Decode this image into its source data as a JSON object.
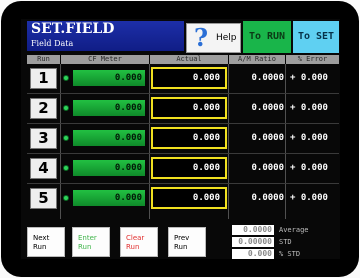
{
  "header": {
    "title": "SET.FIELD",
    "subtitle": "Field Data",
    "help_label": "Help",
    "help_glyph": "?",
    "to_run_label": "To RUN",
    "to_set_label": "To SET"
  },
  "columns": [
    "Run",
    "CF Meter",
    "Actual",
    "A/M Ratio",
    "% Error"
  ],
  "rows": [
    {
      "run": "1",
      "meter": "0.000",
      "actual": "0.000",
      "ratio": "0.0000",
      "error": "+ 0.000"
    },
    {
      "run": "2",
      "meter": "0.000",
      "actual": "0.000",
      "ratio": "0.0000",
      "error": "+ 0.000"
    },
    {
      "run": "3",
      "meter": "0.000",
      "actual": "0.000",
      "ratio": "0.0000",
      "error": "+ 0.000"
    },
    {
      "run": "4",
      "meter": "0.000",
      "actual": "0.000",
      "ratio": "0.0000",
      "error": "+ 0.000"
    },
    {
      "run": "5",
      "meter": "0.000",
      "actual": "0.000",
      "ratio": "0.0000",
      "error": "+ 0.000"
    }
  ],
  "footer": {
    "next_run": [
      "Next",
      "Run"
    ],
    "enter_run": [
      "Enter",
      "Run"
    ],
    "clear_run": [
      "Clear",
      "Run"
    ],
    "prev_run": [
      "Prev",
      "Run"
    ],
    "stats": [
      {
        "value": "0.0000",
        "label": "Average"
      },
      {
        "value": "0.00000",
        "label": "STD"
      },
      {
        "value": "0.000",
        "label": "% STD"
      }
    ]
  },
  "colors": {
    "title_bg": "#1d2fa8",
    "to_run_bg": "#19b54a",
    "to_set_bg": "#5fd0f2",
    "meter_green": "#22c042",
    "actual_border": "#f0e020",
    "enter_text": "#3fb54a",
    "clear_text": "#e23030"
  }
}
